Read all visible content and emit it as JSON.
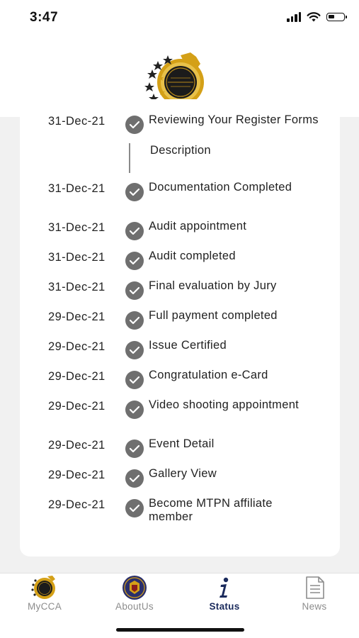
{
  "status_bar": {
    "time": "3:47"
  },
  "timeline": [
    {
      "date": "31-Dec-21",
      "label": "Reviewing Your Register Forms",
      "description": "Description"
    },
    {
      "date": "31-Dec-21",
      "label": "Documentation Completed"
    },
    {
      "date": "31-Dec-21",
      "label": "Audit appointment"
    },
    {
      "date": "31-Dec-21",
      "label": "Audit completed"
    },
    {
      "date": "31-Dec-21",
      "label": "Final evaluation by Jury"
    },
    {
      "date": "29-Dec-21",
      "label": "Full payment completed"
    },
    {
      "date": "29-Dec-21",
      "label": "Issue Certified"
    },
    {
      "date": "29-Dec-21",
      "label": "Congratulation e-Card"
    },
    {
      "date": "29-Dec-21",
      "label": "Video shooting appointment"
    },
    {
      "date": "29-Dec-21",
      "label": "Event Detail"
    },
    {
      "date": "29-Dec-21",
      "label": "Gallery View"
    },
    {
      "date": "29-Dec-21",
      "label": "Become MTPN affiliate member"
    }
  ],
  "tabs": [
    {
      "label": "MyCCA",
      "icon": "mycca-logo-icon",
      "active": false
    },
    {
      "label": "AboutUs",
      "icon": "aboutus-emblem-icon",
      "active": false
    },
    {
      "label": "Status",
      "icon": "info-icon",
      "active": true
    },
    {
      "label": "News",
      "icon": "news-document-icon",
      "active": false
    }
  ],
  "colors": {
    "check": "#6f6f6f",
    "active_tab": "#1a2a5c",
    "inactive_tab": "#8c8c8c",
    "background": "#f1f1f1",
    "logo_gold": "#d4a017"
  }
}
